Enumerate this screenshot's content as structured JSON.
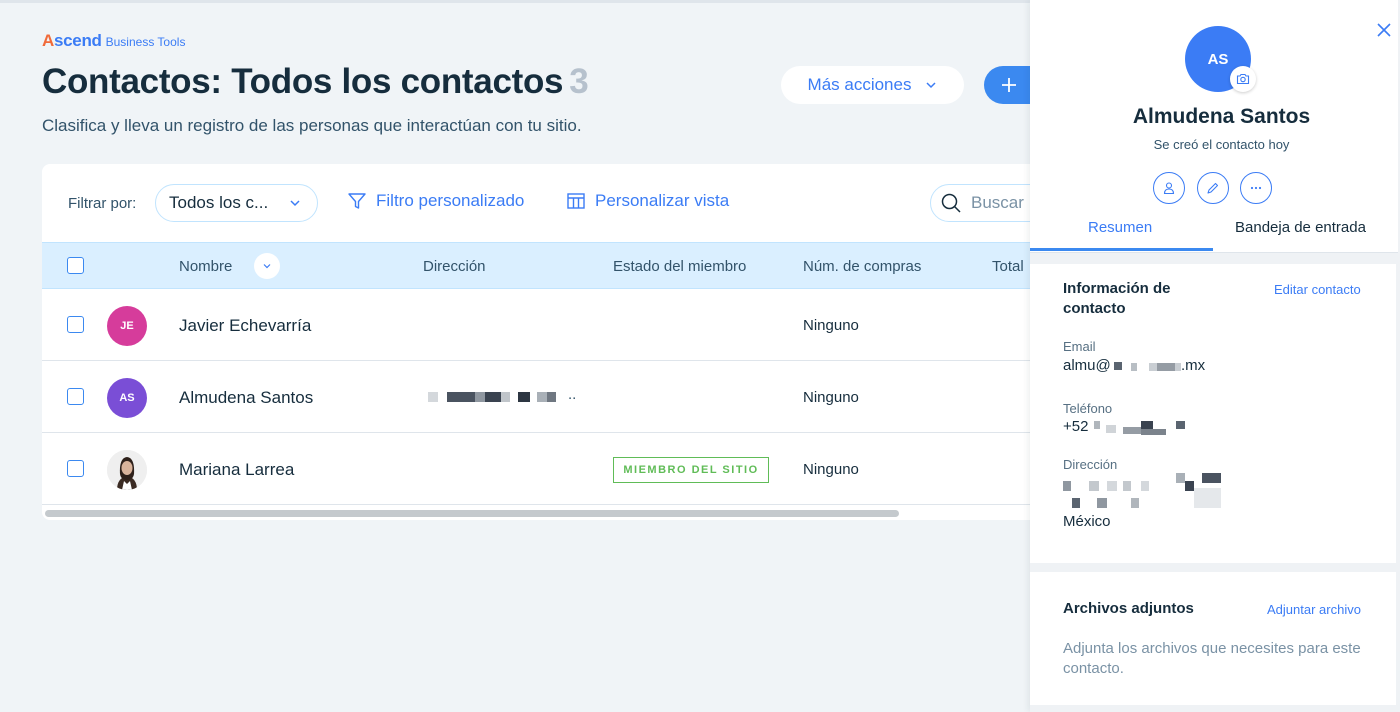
{
  "brand": {
    "name_first": "A",
    "name_rest": "scend",
    "sub": "Business Tools",
    "accent": "#3b7cf5",
    "logo_color": "#f06a3a"
  },
  "header": {
    "title": "Contactos: Todos los contactos",
    "count": "3",
    "subtitle": "Clasifica y lleva un registro de las personas que interactúan con tu sitio.",
    "more_actions_label": "Más acciones",
    "add_icon": "plus-icon"
  },
  "toolbar": {
    "filter_label": "Filtrar por:",
    "filter_value": "Todos los c...",
    "custom_filter_label": "Filtro personalizado",
    "custom_filter_icon": "funnel-icon",
    "customize_view_label": "Personalizar vista",
    "customize_view_icon": "table-columns-icon",
    "search_placeholder": "Buscar"
  },
  "table": {
    "columns": [
      "Nombre",
      "Dirección",
      "Estado del miembro",
      "Núm. de compras",
      "Total"
    ],
    "rows": [
      {
        "initials": "JE",
        "avatar_color": "#d63c9b",
        "name": "Javier Echevarría",
        "address": "",
        "member_status": "",
        "purchases": "Ninguno"
      },
      {
        "initials": "AS",
        "avatar_color": "#7a4ed6",
        "name": "Almudena Santos",
        "address_suffix": "..",
        "member_status": "",
        "purchases": "Ninguno"
      },
      {
        "initials": "",
        "avatar_color": "#e8e8e8",
        "name": "Mariana Larrea",
        "address": "",
        "member_status": "MIEMBRO DEL SITIO",
        "purchases": "Ninguno"
      }
    ]
  },
  "panel": {
    "initials": "AS",
    "avatar_color": "#3b7cf5",
    "name": "Almudena Santos",
    "created": "Se creó el contacto hoy",
    "tabs": [
      "Resumen",
      "Bandeja de entrada"
    ],
    "active_tab": "Resumen",
    "contact_info": {
      "title": "Información de contacto",
      "edit_label": "Editar contacto",
      "email_label": "Email",
      "email_prefix": "almu@",
      "email_suffix": ".mx",
      "phone_label": "Teléfono",
      "phone_prefix": "+52",
      "address_label": "Dirección",
      "address_country": "México"
    },
    "attachments": {
      "title": "Archivos adjuntos",
      "action_label": "Adjuntar archivo",
      "description": "Adjunta los archivos que necesites para este contacto."
    }
  }
}
